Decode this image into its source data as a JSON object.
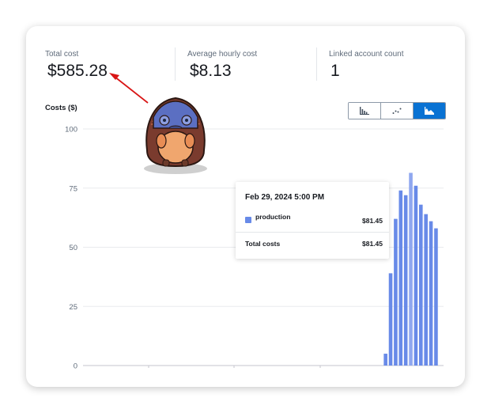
{
  "metrics": [
    {
      "label": "Total cost",
      "value": "$585.28"
    },
    {
      "label": "Average hourly cost",
      "value": "$8.13"
    },
    {
      "label": "Linked account count",
      "value": "1"
    }
  ],
  "view_toggles": [
    {
      "icon": "bar-chart-icon",
      "active": false
    },
    {
      "icon": "scatter-chart-icon",
      "active": false
    },
    {
      "icon": "area-chart-icon",
      "active": true
    }
  ],
  "tooltip": {
    "title": "Feb 29, 2024 5:00 PM",
    "series_name": "production",
    "series_value": "$81.45",
    "total_label": "Total costs",
    "total_value": "$81.45"
  },
  "colors": {
    "bar": "#688ae8",
    "bar_highlight": "#8fa7ef",
    "accent": "#0972d3",
    "annotation_arrow": "#d91515"
  },
  "chart_data": {
    "type": "bar",
    "ylabel": "Costs ($)",
    "ylim": [
      0,
      100
    ],
    "yticks": [
      0,
      25,
      50,
      75,
      100
    ],
    "grid": true,
    "x": [
      0,
      1,
      2,
      3,
      4,
      5,
      6,
      7,
      8,
      9,
      10
    ],
    "xlim": [
      -60,
      11.5
    ],
    "highlight_index": 5,
    "series": [
      {
        "name": "production",
        "values": [
          5,
          39,
          62,
          74,
          72,
          81.45,
          76,
          68,
          64,
          61,
          58
        ]
      }
    ]
  }
}
